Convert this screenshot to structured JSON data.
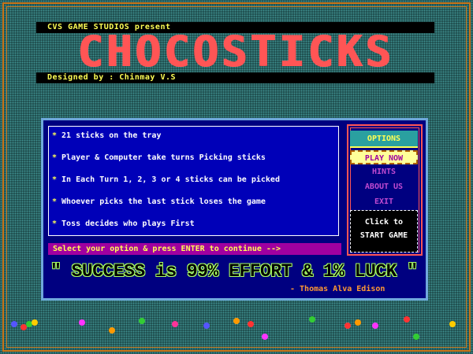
{
  "header": {
    "presents": "CVS GAME STUDIOS present",
    "title": "CHOCOSTICKS",
    "designer": "Designed by : Chinmay V.S"
  },
  "rules": [
    "21 sticks on the tray",
    "Player & Computer take turns Picking sticks",
    "In Each Turn 1, 2, 3 or 4 sticks can be picked",
    "Whoever picks the last stick loses the game",
    "Toss decides who plays First"
  ],
  "bullet": "*",
  "prompt": "Select your option & press ENTER to continue -->",
  "menu": {
    "options": "OPTIONS",
    "play": "PLAY NOW",
    "hints": "HINTS",
    "about": "ABOUT US",
    "exit": "EXIT"
  },
  "start": {
    "line1": "Click to",
    "line2": "START GAME"
  },
  "quote": "\" SUCCESS is 99% EFFORT & 1% LUCK \"",
  "author": "- Thomas Alva Edison",
  "colors": {
    "title": "#ff5555",
    "accent_yellow": "#ffff55",
    "panel_blue": "#000080",
    "menu_purple": "#c04ad0",
    "frame_orange": "#c87418"
  }
}
